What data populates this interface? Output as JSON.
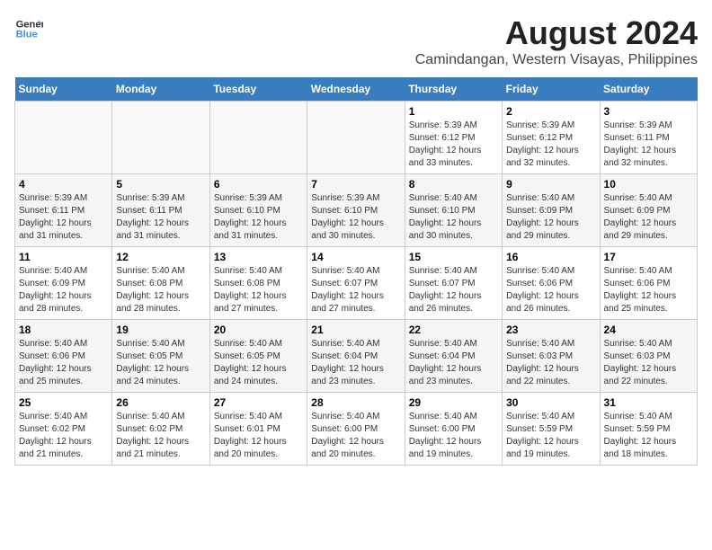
{
  "header": {
    "logo_line1": "General",
    "logo_line2": "Blue",
    "month_year": "August 2024",
    "location": "Camindangan, Western Visayas, Philippines"
  },
  "days_of_week": [
    "Sunday",
    "Monday",
    "Tuesday",
    "Wednesday",
    "Thursday",
    "Friday",
    "Saturday"
  ],
  "weeks": [
    [
      {
        "day": "",
        "info": ""
      },
      {
        "day": "",
        "info": ""
      },
      {
        "day": "",
        "info": ""
      },
      {
        "day": "",
        "info": ""
      },
      {
        "day": "1",
        "info": "Sunrise: 5:39 AM\nSunset: 6:12 PM\nDaylight: 12 hours\nand 33 minutes."
      },
      {
        "day": "2",
        "info": "Sunrise: 5:39 AM\nSunset: 6:12 PM\nDaylight: 12 hours\nand 32 minutes."
      },
      {
        "day": "3",
        "info": "Sunrise: 5:39 AM\nSunset: 6:11 PM\nDaylight: 12 hours\nand 32 minutes."
      }
    ],
    [
      {
        "day": "4",
        "info": "Sunrise: 5:39 AM\nSunset: 6:11 PM\nDaylight: 12 hours\nand 31 minutes."
      },
      {
        "day": "5",
        "info": "Sunrise: 5:39 AM\nSunset: 6:11 PM\nDaylight: 12 hours\nand 31 minutes."
      },
      {
        "day": "6",
        "info": "Sunrise: 5:39 AM\nSunset: 6:10 PM\nDaylight: 12 hours\nand 31 minutes."
      },
      {
        "day": "7",
        "info": "Sunrise: 5:39 AM\nSunset: 6:10 PM\nDaylight: 12 hours\nand 30 minutes."
      },
      {
        "day": "8",
        "info": "Sunrise: 5:40 AM\nSunset: 6:10 PM\nDaylight: 12 hours\nand 30 minutes."
      },
      {
        "day": "9",
        "info": "Sunrise: 5:40 AM\nSunset: 6:09 PM\nDaylight: 12 hours\nand 29 minutes."
      },
      {
        "day": "10",
        "info": "Sunrise: 5:40 AM\nSunset: 6:09 PM\nDaylight: 12 hours\nand 29 minutes."
      }
    ],
    [
      {
        "day": "11",
        "info": "Sunrise: 5:40 AM\nSunset: 6:09 PM\nDaylight: 12 hours\nand 28 minutes."
      },
      {
        "day": "12",
        "info": "Sunrise: 5:40 AM\nSunset: 6:08 PM\nDaylight: 12 hours\nand 28 minutes."
      },
      {
        "day": "13",
        "info": "Sunrise: 5:40 AM\nSunset: 6:08 PM\nDaylight: 12 hours\nand 27 minutes."
      },
      {
        "day": "14",
        "info": "Sunrise: 5:40 AM\nSunset: 6:07 PM\nDaylight: 12 hours\nand 27 minutes."
      },
      {
        "day": "15",
        "info": "Sunrise: 5:40 AM\nSunset: 6:07 PM\nDaylight: 12 hours\nand 26 minutes."
      },
      {
        "day": "16",
        "info": "Sunrise: 5:40 AM\nSunset: 6:06 PM\nDaylight: 12 hours\nand 26 minutes."
      },
      {
        "day": "17",
        "info": "Sunrise: 5:40 AM\nSunset: 6:06 PM\nDaylight: 12 hours\nand 25 minutes."
      }
    ],
    [
      {
        "day": "18",
        "info": "Sunrise: 5:40 AM\nSunset: 6:06 PM\nDaylight: 12 hours\nand 25 minutes."
      },
      {
        "day": "19",
        "info": "Sunrise: 5:40 AM\nSunset: 6:05 PM\nDaylight: 12 hours\nand 24 minutes."
      },
      {
        "day": "20",
        "info": "Sunrise: 5:40 AM\nSunset: 6:05 PM\nDaylight: 12 hours\nand 24 minutes."
      },
      {
        "day": "21",
        "info": "Sunrise: 5:40 AM\nSunset: 6:04 PM\nDaylight: 12 hours\nand 23 minutes."
      },
      {
        "day": "22",
        "info": "Sunrise: 5:40 AM\nSunset: 6:04 PM\nDaylight: 12 hours\nand 23 minutes."
      },
      {
        "day": "23",
        "info": "Sunrise: 5:40 AM\nSunset: 6:03 PM\nDaylight: 12 hours\nand 22 minutes."
      },
      {
        "day": "24",
        "info": "Sunrise: 5:40 AM\nSunset: 6:03 PM\nDaylight: 12 hours\nand 22 minutes."
      }
    ],
    [
      {
        "day": "25",
        "info": "Sunrise: 5:40 AM\nSunset: 6:02 PM\nDaylight: 12 hours\nand 21 minutes."
      },
      {
        "day": "26",
        "info": "Sunrise: 5:40 AM\nSunset: 6:02 PM\nDaylight: 12 hours\nand 21 minutes."
      },
      {
        "day": "27",
        "info": "Sunrise: 5:40 AM\nSunset: 6:01 PM\nDaylight: 12 hours\nand 20 minutes."
      },
      {
        "day": "28",
        "info": "Sunrise: 5:40 AM\nSunset: 6:00 PM\nDaylight: 12 hours\nand 20 minutes."
      },
      {
        "day": "29",
        "info": "Sunrise: 5:40 AM\nSunset: 6:00 PM\nDaylight: 12 hours\nand 19 minutes."
      },
      {
        "day": "30",
        "info": "Sunrise: 5:40 AM\nSunset: 5:59 PM\nDaylight: 12 hours\nand 19 minutes."
      },
      {
        "day": "31",
        "info": "Sunrise: 5:40 AM\nSunset: 5:59 PM\nDaylight: 12 hours\nand 18 minutes."
      }
    ]
  ]
}
